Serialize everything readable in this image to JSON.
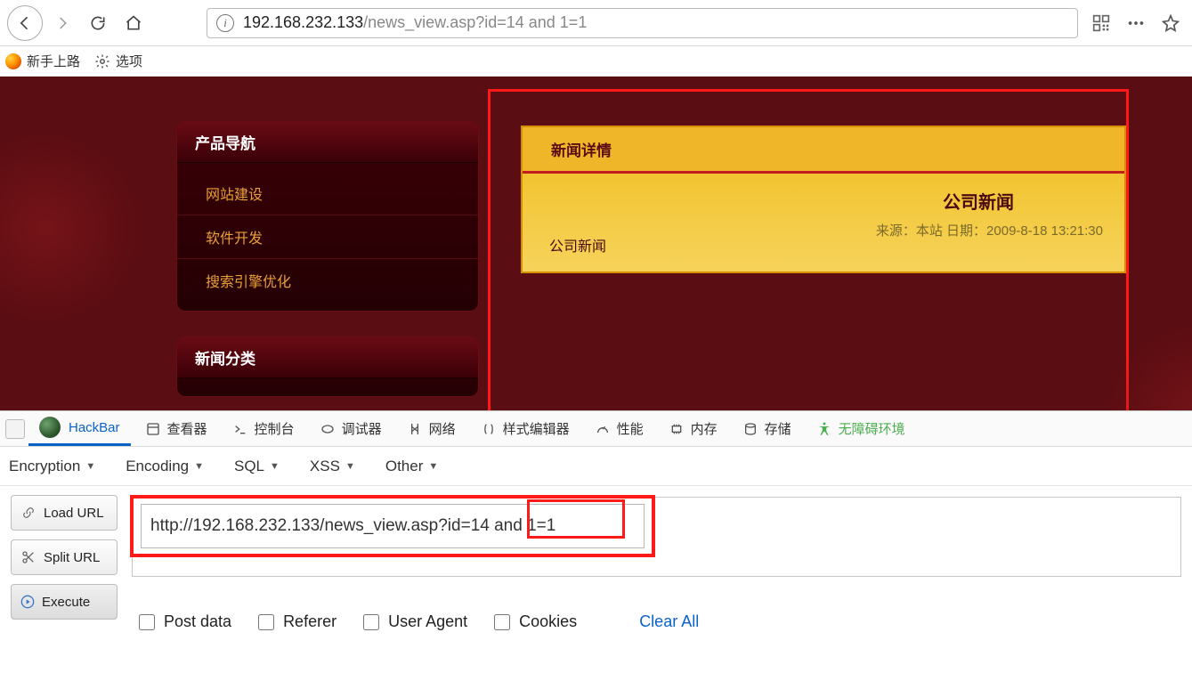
{
  "browser": {
    "url_host": "192.168.232.133",
    "url_path": "/news_view.asp?id=14 and 1=1"
  },
  "bookmarks": {
    "item1": "新手上路",
    "item2": "选项"
  },
  "sidebar": {
    "nav_title": "产品导航",
    "items": [
      "网站建设",
      "软件开发",
      "搜索引擎优化"
    ],
    "cat_title": "新闻分类"
  },
  "news": {
    "header": "新闻详情",
    "title": "公司新闻",
    "meta": "来源：本站 日期：2009-8-18 13:21:30",
    "body_text": "公司新闻"
  },
  "devtools": {
    "tabs": {
      "hackbar": "HackBar",
      "inspector": "查看器",
      "console": "控制台",
      "debugger": "调试器",
      "network": "网络",
      "style": "样式编辑器",
      "perf": "性能",
      "memory": "内存",
      "storage": "存储",
      "a11y": "无障碍环境"
    }
  },
  "hackbar": {
    "menus": {
      "encryption": "Encryption",
      "encoding": "Encoding",
      "sql": "SQL",
      "xss": "XSS",
      "other": "Other"
    },
    "buttons": {
      "load": "Load URL",
      "split": "Split URL",
      "execute": "Execute"
    },
    "url_value": "http://192.168.232.133/news_view.asp?id=14 and 1=1",
    "checks": {
      "post": "Post data",
      "referer": "Referer",
      "ua": "User Agent",
      "cookies": "Cookies"
    },
    "clear_all": "Clear All"
  }
}
